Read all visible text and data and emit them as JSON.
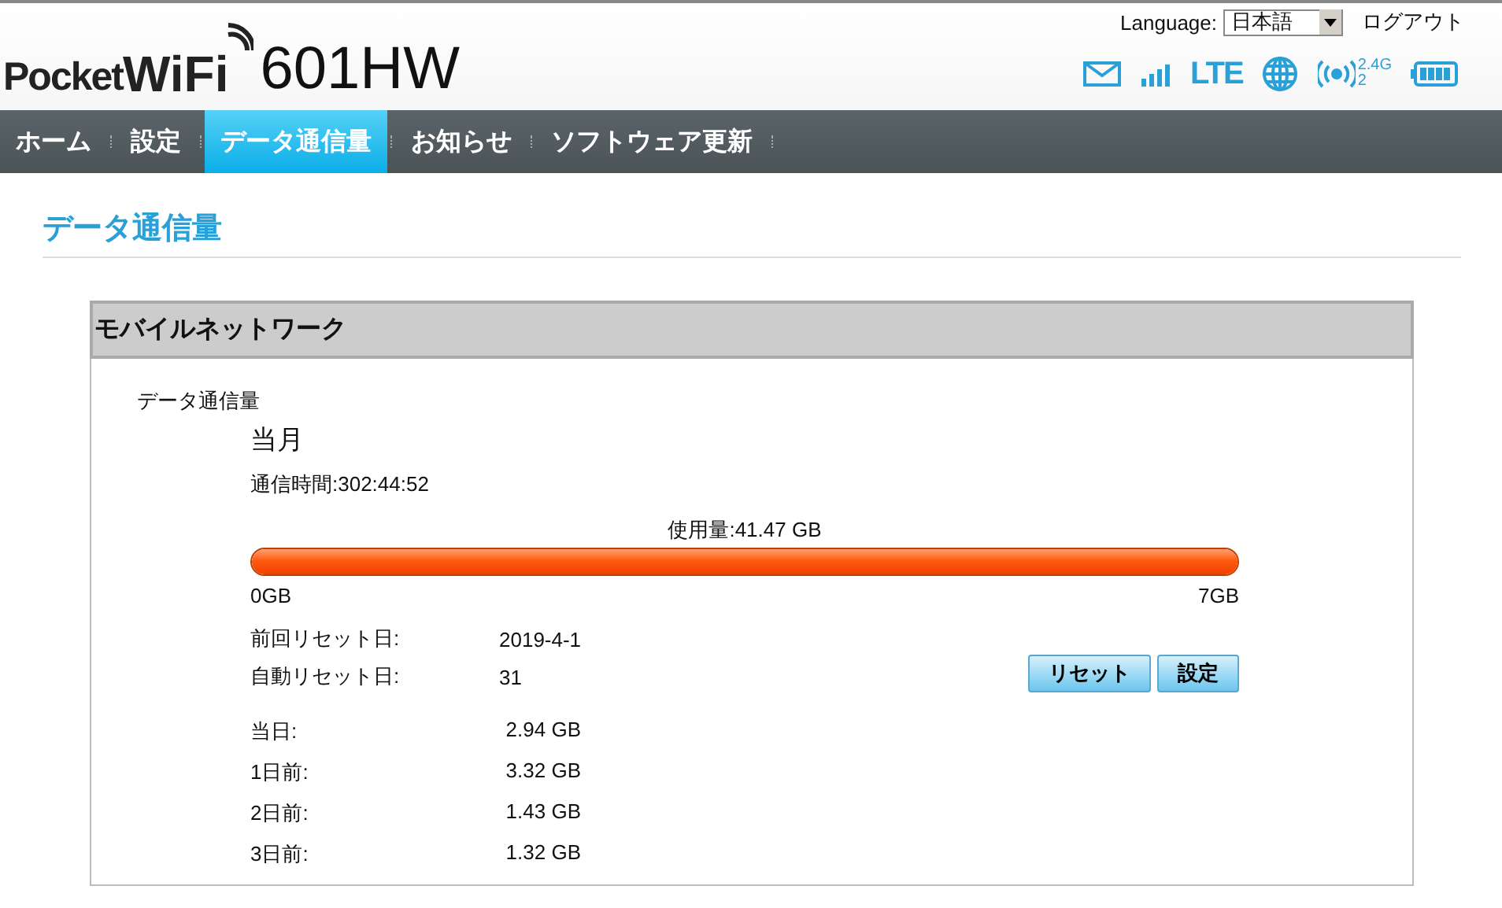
{
  "header": {
    "logo_pocket": "Pocket",
    "logo_wifi": "WiFi",
    "model": "601HW",
    "language_label": "Language:",
    "language": "日本語",
    "logout": "ログアウト",
    "network_type": "LTE",
    "wifi_band": "2.4G",
    "wifi_clients": "2"
  },
  "nav": [
    {
      "label": "ホーム",
      "selected": false
    },
    {
      "label": "設定",
      "selected": false
    },
    {
      "label": "データ通信量",
      "selected": true
    },
    {
      "label": "お知らせ",
      "selected": false
    },
    {
      "label": "ソフトウェア更新",
      "selected": false
    }
  ],
  "page_title": "データ通信量",
  "panel": {
    "title": "モバイルネットワーク",
    "section": "データ通信量",
    "period": "当月",
    "duration": "通信時間:302:44:52",
    "usage": "使用量:41.47 GB",
    "level": 1,
    "min": "0GB",
    "max": "7GB",
    "resets": [
      {
        "label": "前回リセット日:",
        "value": "2019-4-1"
      },
      {
        "label": "自動リセット日:",
        "value": "31"
      }
    ],
    "buttons": [
      "リセット",
      "設定"
    ],
    "daily": [
      {
        "label": "当日:",
        "value": "2.94 GB"
      },
      {
        "label": "1日前:",
        "value": "3.32 GB"
      },
      {
        "label": "2日前:",
        "value": "1.43 GB"
      },
      {
        "label": "3日前:",
        "value": "1.32 GB"
      }
    ]
  }
}
